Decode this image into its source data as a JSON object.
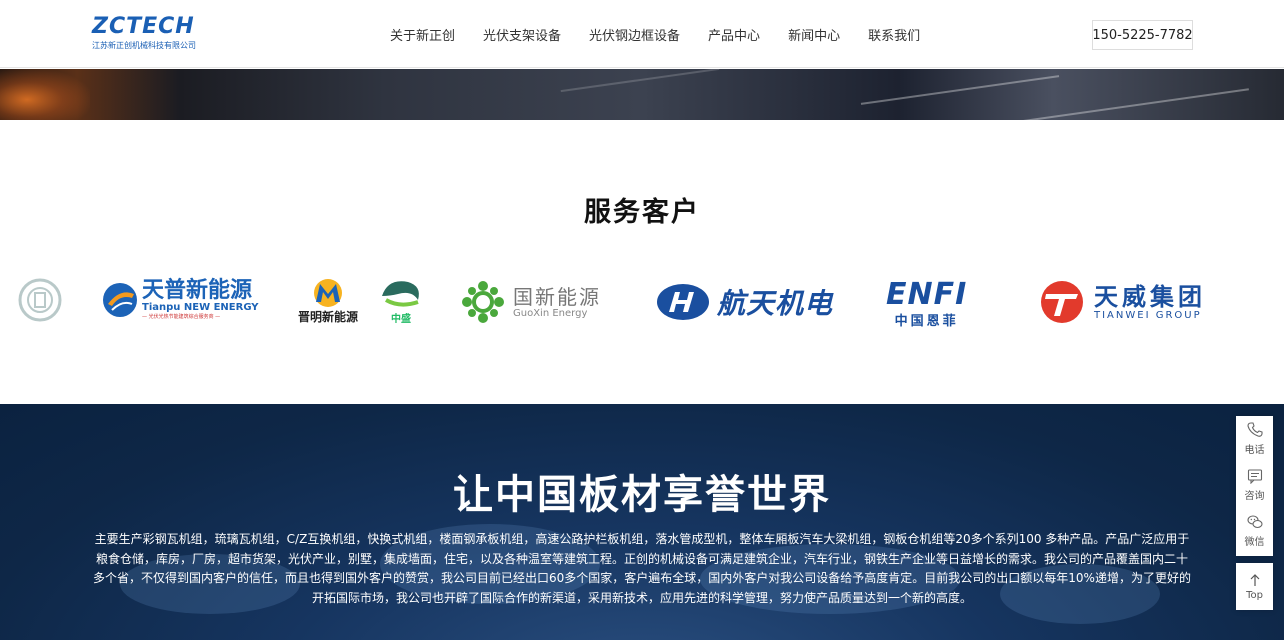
{
  "header": {
    "logo": {
      "main": "ZCTECH",
      "sub": "江苏新正创机械科技有限公司"
    },
    "nav": [
      "关于新正创",
      "光伏支架设备",
      "光伏钢边框设备",
      "产品中心",
      "新闻中心",
      "联系我们"
    ],
    "phone": "150-5225-7782"
  },
  "clients": {
    "title": "服务客户",
    "logos": {
      "tianpu": {
        "cn": "天普新能源",
        "en": "Tianpu NEW ENERGY",
        "tag": "— 光伏光热节能建筑综合服务商 —"
      },
      "jinming": {
        "cn": "晋明新能源"
      },
      "zhongsheng": {
        "cn": "中盛"
      },
      "guoxin": {
        "cn": "国新能源",
        "en": "GuoXin Energy"
      },
      "hangtian": {
        "cn": "航天机电"
      },
      "enfi": {
        "en": "ENFI",
        "cn": "中国恩菲"
      },
      "tianwei": {
        "cn": "天威集团",
        "en": "TIANWEI GROUP"
      }
    }
  },
  "mission": {
    "title": "让中国板材享誉世界",
    "text": "主要生产彩钢瓦机组，琉璃瓦机组，C/Z互换机组，快换式机组，楼面钢承板机组，高速公路护栏板机组，落水管成型机，整体车厢板汽车大梁机组，钢板仓机组等20多个系列100 多种产品。产品广泛应用于粮食仓储，库房，厂房，超市货架，光伏产业，别墅，集成墙面，住宅，以及各种温室等建筑工程。正创的机械设备可满足建筑企业，汽车行业，钢铁生产企业等日益增长的需求。我公司的产品覆盖国内二十多个省，不仅得到国内客户的信任，而且也得到国外客户的赞赏，我公司目前已经出口60多个国家，客户遍布全球，国内外客户对我公司设备给予高度肯定。目前我公司的出口额以每年10%递增，为了更好的开拓国际市场，我公司也开辟了国际合作的新渠道，采用新技术，应用先进的科学管理，努力使产品质量达到一个新的高度。"
  },
  "side": {
    "items": [
      {
        "label": "电话",
        "icon": "phone-icon"
      },
      {
        "label": "咨询",
        "icon": "chat-icon"
      },
      {
        "label": "微信",
        "icon": "wechat-icon"
      }
    ],
    "top": "Top"
  },
  "colors": {
    "brand": "#1a5fb4",
    "dark_section": "#0e2747",
    "tianwei_red": "#e23a2c"
  }
}
